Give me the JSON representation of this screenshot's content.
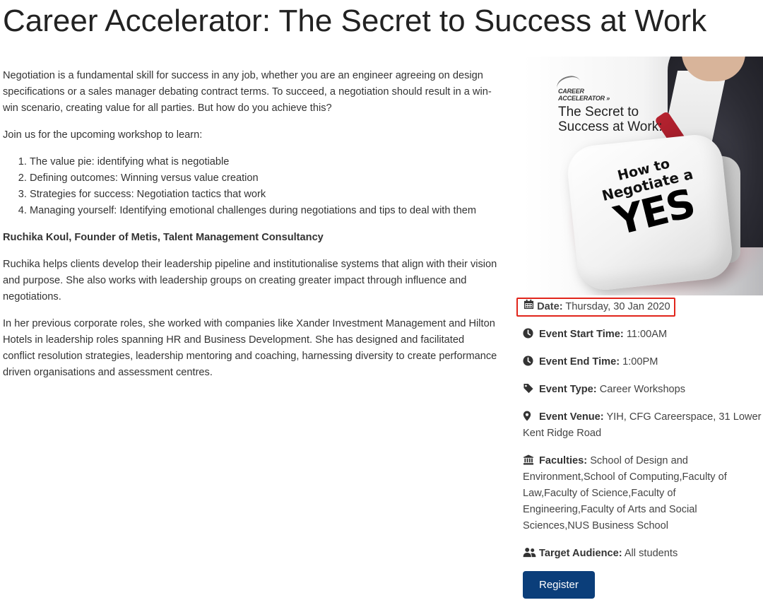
{
  "page": {
    "title": "Career Accelerator: The Secret to Success at Work"
  },
  "description": {
    "intro": "Negotiation is a fundamental skill for success in any job, whether you are an engineer agreeing on design specifications or a sales manager debating contract terms. To succeed, a negotiation should result in a win-win scenario, creating value for all parties. But how do you achieve this?",
    "join": "Join us for the upcoming workshop to learn:",
    "topics": [
      "The value pie: identifying what is negotiable",
      "Defining outcomes: Winning versus value creation",
      "Strategies for success: Negotiation tactics that work",
      "Managing yourself: Identifying emotional challenges during negotiations and tips to deal with them"
    ],
    "speaker": "Ruchika Koul, Founder of Metis, Talent Management Consultancy",
    "bio_1": "Ruchika helps clients develop their leadership pipeline and institutionalise systems that align with their vision and purpose. She also works with leadership groups on creating greater impact through influence and negotiations.",
    "bio_2": "In her previous corporate roles, she worked with companies like Xander Investment Management and Hilton Hotels in leadership roles spanning HR and Business Development. She has designed and facilitated conflict resolution strategies, leadership mentoring and coaching, harnessing diversity to create performance driven organisations and assessment centres."
  },
  "poster": {
    "logo_line1": "CAREER",
    "logo_line2": "ACCELERATOR",
    "tagline": "The Secret to Success at Work:",
    "dice_line1": "How to",
    "dice_line2": "Negotiate a",
    "dice_yes": "YES"
  },
  "event": {
    "date": {
      "label": "Date:",
      "value": "Thursday, 30 Jan 2020",
      "icon": "calendar-icon"
    },
    "start_time": {
      "label": "Event Start Time:",
      "value": "11:00AM",
      "icon": "clock-icon"
    },
    "end_time": {
      "label": "Event End Time:",
      "value": "1:00PM",
      "icon": "clock-icon"
    },
    "type": {
      "label": "Event Type:",
      "value": "Career Workshops",
      "icon": "tag-icon"
    },
    "venue": {
      "label": "Event Venue:",
      "value": "YIH, CFG Careerspace, 31 Lower Kent Ridge Road",
      "icon": "map-marker-icon"
    },
    "faculties": {
      "label": "Faculties:",
      "value": "School of Design and Environment,School of Computing,Faculty of Law,Faculty of Science,Faculty of Engineering,Faculty of Arts and Social Sciences,NUS Business School",
      "icon": "institution-icon"
    },
    "audience": {
      "label": "Target Audience:",
      "value": "All students",
      "icon": "users-icon"
    },
    "register_label": "Register"
  },
  "colors": {
    "register_button": "#0b3e7a",
    "highlight_border": "#e1251b",
    "text": "#333333"
  }
}
